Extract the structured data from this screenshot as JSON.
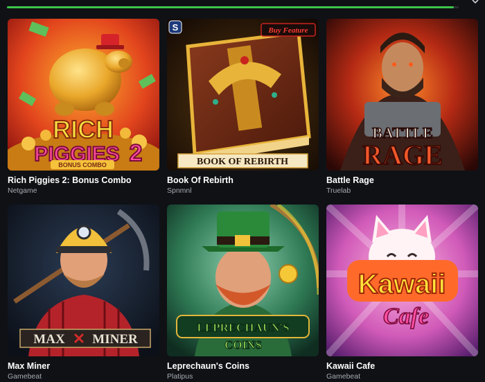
{
  "top_progress": {
    "fraction": 0.99
  },
  "games": [
    {
      "title": "Rich Piggies 2: Bonus Combo",
      "provider": "Netgame",
      "art_line1": "RICH",
      "art_line2": "PIGGIES",
      "art_num": "2",
      "art_sub": "BONUS COMBO"
    },
    {
      "title": "Book Of Rebirth",
      "provider": "Spnmnl",
      "art_title": "BOOK OF REBIRTH",
      "badge": "Buy Feature",
      "corner_badge": "S"
    },
    {
      "title": "Battle Rage",
      "provider": "Truelab",
      "art_line1": "BATTLE",
      "art_line2": "RAGE"
    },
    {
      "title": "Max Miner",
      "provider": "Gamebeat",
      "art_line1": "MAX",
      "art_line2": "MINER"
    },
    {
      "title": "Leprechaun's Coins",
      "provider": "Platipus",
      "art_line1": "LEPRECHAUN'S",
      "art_line2": "COINS"
    },
    {
      "title": "Kawaii Cafe",
      "provider": "Gamebeat",
      "art_line1": "Kawaii",
      "art_line2": "Cafe"
    }
  ]
}
